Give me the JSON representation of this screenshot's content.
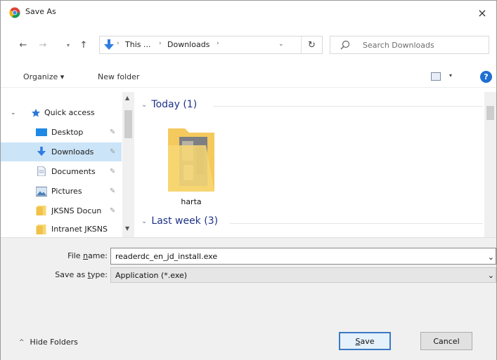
{
  "window": {
    "title": "Save As",
    "close_glyph": "×"
  },
  "nav": {
    "back_glyph": "←",
    "forward_glyph": "→",
    "recent_glyph": "▾",
    "up_glyph": "↑",
    "breadcrumbs": [
      "This ...",
      "Downloads"
    ],
    "crumb_sep": "›",
    "dropdown_glyph": "⌄",
    "refresh_glyph": "↻",
    "search_placeholder": "Search Downloads"
  },
  "toolbar": {
    "organize_label": "Organize ▾",
    "new_folder_label": "New folder",
    "view_drop_glyph": "▾",
    "help_glyph": "?"
  },
  "sidebar": {
    "quick_access_label": "Quick access",
    "items": [
      {
        "label": "Desktop",
        "icon": "desktop-icon"
      },
      {
        "label": "Downloads",
        "icon": "download-arrow-icon",
        "selected": true
      },
      {
        "label": "Documents",
        "icon": "documents-icon"
      },
      {
        "label": "Pictures",
        "icon": "pictures-icon"
      },
      {
        "label": "JKSNS Docun",
        "icon": "folder-icon"
      },
      {
        "label": "Intranet JKSNS",
        "icon": "folder-icon"
      }
    ],
    "pin_glyph": "✎"
  },
  "files": {
    "groups": [
      {
        "label": "Today (1)"
      },
      {
        "label": "Last week (3)"
      }
    ],
    "items": [
      {
        "name": "harta",
        "icon": "folder-with-image-icon"
      }
    ]
  },
  "form": {
    "file_name_label_pre": "File ",
    "file_name_label_u": "n",
    "file_name_label_post": "ame:",
    "file_name_value": "readerdc_en_jd_install.exe",
    "save_type_label_pre": "Save as ",
    "save_type_label_u": "t",
    "save_type_label_post": "ype:",
    "save_type_value": "Application (*.exe)",
    "combo_glyph": "⌄"
  },
  "footer": {
    "hide_folders_caret": "^",
    "hide_folders_label": "Hide Folders",
    "save_u": "S",
    "save_rest": "ave",
    "cancel_label": "Cancel"
  },
  "colors": {
    "selection": "#cce4f7",
    "accent": "#1f6fd1",
    "group_header": "#1e3287"
  }
}
